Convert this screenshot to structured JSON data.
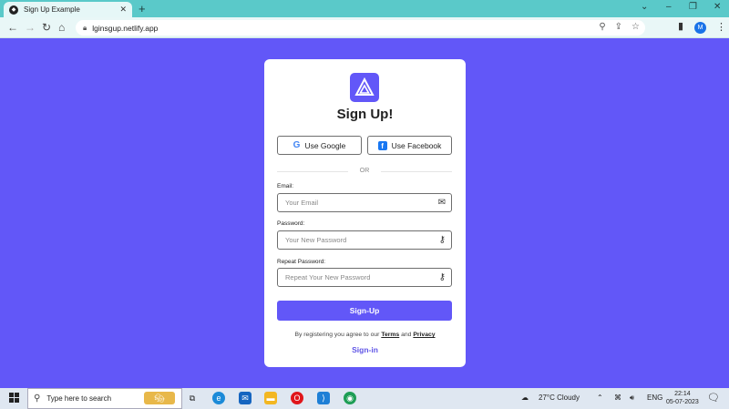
{
  "browser": {
    "tab_title": "Sign Up Example",
    "url": "lginsgup.netlify.app",
    "avatar_letter": "M"
  },
  "card": {
    "heading": "Sign Up!",
    "google_label": "Use Google",
    "facebook_label": "Use Facebook",
    "or_text": "OR",
    "email_label": "Email:",
    "email_placeholder": "Your Email",
    "password_label": "Password:",
    "password_placeholder": "Your New Password",
    "repeat_label": "Repeat Password:",
    "repeat_placeholder": "Repeat Your New Password",
    "submit_label": "Sign-Up",
    "terms_prefix": "By registering you agree to our",
    "terms_link": "Terms",
    "terms_and": "and",
    "privacy_link": "Privacy",
    "signin_label": "Sign-in"
  },
  "taskbar": {
    "search_placeholder": "Type here to search",
    "weather": "27°C  Cloudy",
    "language": "ENG",
    "time": "22:14",
    "date": "05-07-2023"
  },
  "colors": {
    "background": "#6257f8",
    "accent": "#6257f8",
    "tabbar": "#5ac9c9"
  }
}
